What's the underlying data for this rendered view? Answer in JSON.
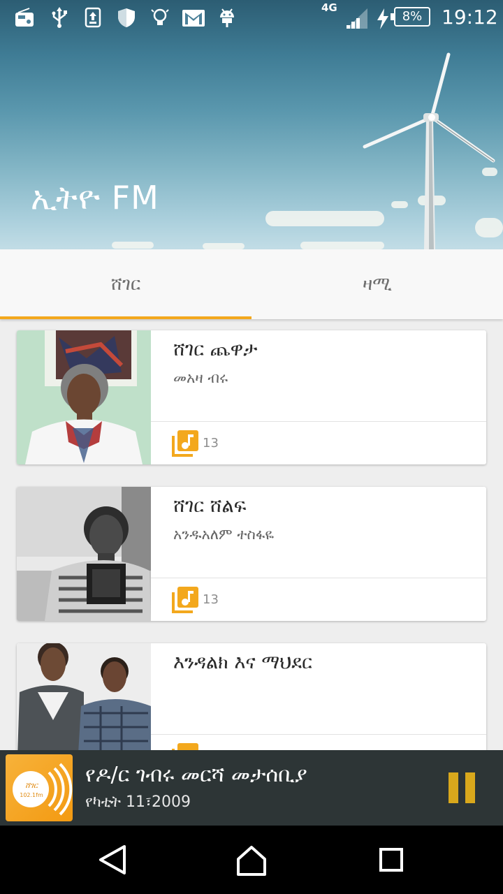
{
  "status_bar": {
    "network": "4G",
    "battery": "8%",
    "time": "19:12",
    "icons": [
      "radio-icon",
      "usb-icon",
      "upload-icon",
      "shield-icon",
      "lightbulb-icon",
      "gmail-icon",
      "android-icon",
      "signal-icon",
      "charging-icon",
      "battery-icon"
    ]
  },
  "header": {
    "title": "ኢትዮ FM"
  },
  "tabs": [
    {
      "label": "ሸገር",
      "selected": true
    },
    {
      "label": "ዛሚ",
      "selected": false
    }
  ],
  "accent_color": "#f3a81d",
  "programs": [
    {
      "title": "ሸገር ጨዋታ",
      "host": "መአዛ ብሩ",
      "count": "13"
    },
    {
      "title": "ሸገር ሸልፍ",
      "host": "አንዱአለም ተስፋዬ",
      "count": "13"
    },
    {
      "title": "እንዳልክ እና ማህደር",
      "host": "",
      "count": ""
    }
  ],
  "player": {
    "title": "የዶ/ር ገብሩ መርሻ መታሰቢያ",
    "subtitle": "የካቲት 11፣2009",
    "logo_text": "ሸገር",
    "logo_freq": "102.1fm",
    "state": "playing"
  },
  "nav": {
    "icons": [
      "back-icon",
      "home-icon",
      "recents-icon"
    ]
  }
}
